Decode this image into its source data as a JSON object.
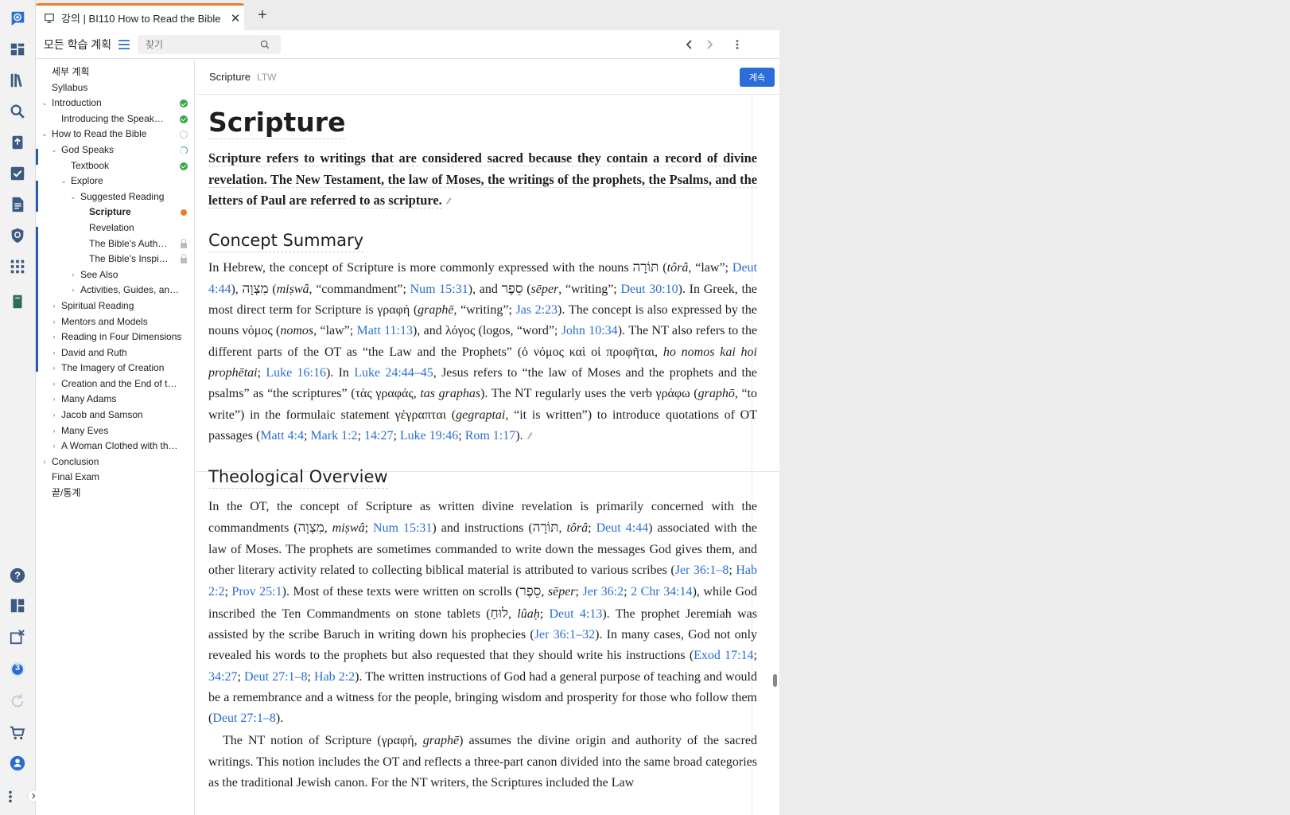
{
  "tab": {
    "title": "강의 | BI110 How to Read the Bible"
  },
  "toolbar": {
    "plan_label": "모든 학습 계획",
    "search_placeholder": "찾기"
  },
  "tree": [
    {
      "label": "세부 계획",
      "level": 0,
      "chevron": "none"
    },
    {
      "label": "Syllabus",
      "level": 0,
      "chevron": "none"
    },
    {
      "label": "Introduction",
      "level": 0,
      "chevron": "open",
      "status": "done"
    },
    {
      "label": "Introducing the Speak…",
      "level": 1,
      "chevron": "none",
      "status": "done"
    },
    {
      "label": "How to Read the Bible",
      "level": 0,
      "chevron": "open",
      "status": "empty"
    },
    {
      "label": "God Speaks",
      "level": 1,
      "chevron": "open",
      "status": "half"
    },
    {
      "label": "Textbook",
      "level": 2,
      "chevron": "none",
      "status": "done"
    },
    {
      "label": "Explore",
      "level": 2,
      "chevron": "open"
    },
    {
      "label": "Suggested Reading",
      "level": 3,
      "chevron": "open"
    },
    {
      "label": "Scripture",
      "level": 4,
      "chevron": "none",
      "status": "current",
      "active": true
    },
    {
      "label": "Revelation",
      "level": 4,
      "chevron": "none"
    },
    {
      "label": "The Bible's Auth…",
      "level": 4,
      "chevron": "none",
      "status": "locked"
    },
    {
      "label": "The Bible's Inspi…",
      "level": 4,
      "chevron": "none",
      "status": "locked"
    },
    {
      "label": "See Also",
      "level": 3,
      "chevron": "closed"
    },
    {
      "label": "Activities, Guides, and…",
      "level": 3,
      "chevron": "closed"
    },
    {
      "label": "Spiritual Reading",
      "level": 1,
      "chevron": "closed"
    },
    {
      "label": "Mentors and Models",
      "level": 1,
      "chevron": "closed"
    },
    {
      "label": "Reading in Four Dimensions",
      "level": 1,
      "chevron": "closed"
    },
    {
      "label": "David and Ruth",
      "level": 1,
      "chevron": "closed"
    },
    {
      "label": "The Imagery of Creation",
      "level": 1,
      "chevron": "closed"
    },
    {
      "label": "Creation and the End of th…",
      "level": 1,
      "chevron": "closed"
    },
    {
      "label": "Many Adams",
      "level": 1,
      "chevron": "closed"
    },
    {
      "label": "Jacob and Samson",
      "level": 1,
      "chevron": "closed"
    },
    {
      "label": "Many Eves",
      "level": 1,
      "chevron": "closed"
    },
    {
      "label": "A Woman Clothed with th…",
      "level": 1,
      "chevron": "closed"
    },
    {
      "label": "Conclusion",
      "level": 0,
      "chevron": "closed"
    },
    {
      "label": "Final Exam",
      "level": 0,
      "chevron": "none"
    },
    {
      "label": "끝/통계",
      "level": 0,
      "chevron": "none"
    }
  ],
  "reader": {
    "title": "Scripture",
    "source": "LTW",
    "continue_label": "계속"
  },
  "article": {
    "title": "Scripture",
    "lead": "Scripture refers to writings that are considered sacred because they contain a record of divine revelation. The New Testament, the law of Moses, the writings of the prophets, the Psalms, and the letters of Paul are referred to as scripture.",
    "sec1": "Concept Summary",
    "p1": {
      "a": "In Hebrew, the concept of Scripture is more commonly expressed with the nouns ",
      "heb_tora": "תּוֹרָה",
      "b": " (",
      "tora": "tôrâ",
      "c": ", “law”; ",
      "r_deut444": "Deut 4:44",
      "d": "), ",
      "heb_mitswa": "מִצְוָה",
      "e": " (",
      "mitswa": "miṣwâ",
      "f": ", “commandment”; ",
      "r_num1531": "Num 15:31",
      "g": "), and ",
      "heb_seper": "סֵפֶר",
      "h": " (",
      "seper": "sēper",
      "i": ", “writing”; ",
      "r_deut3010": "Deut 30:10",
      "j": "). In Greek, the most direct term for Scripture is γραφή (",
      "graphe": "graphē",
      "k": ", “writing”; ",
      "r_jas223": "Jas 2:23",
      "l": "). The concept is also expressed by the nouns νόμος (",
      "nomos": "nomos",
      "m": ", “law”; ",
      "r_matt1113": "Matt 11:13",
      "n": "), and λόγος (logos, “word”; ",
      "r_john1034": "John 10:34",
      "o": "). The NT also refers to the different parts of the OT as “the Law and the Prophets” (ὁ νόμος καὶ οἱ προφῆται, ",
      "translit": "ho nomos kai hoi prophētai",
      "p": "; ",
      "r_luke1616": "Luke 16:16",
      "q": "). In ",
      "r_luke2444": "Luke 24:44–45",
      "r": ", Jesus refers to “the law of Moses and the prophets and the psalms” as “the scriptures” (τὰς γραφάς, ",
      "tasgraphas": "tas graphas",
      "s": "). The NT regularly uses the verb γράφω (",
      "grapho": "graphō",
      "t": ", “to write”) in the formulaic statement γέγραπται (",
      "gegraptai": "gegraptai",
      "u": ", “it is written”) to introduce quotations of OT passages (",
      "r_matt44": "Matt 4:4",
      "v": "; ",
      "r_mark12": "Mark 1:2",
      "w": "; ",
      "r_1427": "14:27",
      "x": "; ",
      "r_luke1946": "Luke 19:46",
      "y": "; ",
      "r_rom117": "Rom 1:17",
      "z": ")."
    },
    "sec2": "Theological Overview",
    "p2": {
      "a": "In the OT, the concept of Scripture as written divine revelation is primarily concerned with the commandments (",
      "heb_mitswa": "מִצְוָה",
      "b": ", ",
      "mitswa": "miṣwâ",
      "c": "; ",
      "r_num1531": "Num 15:31",
      "d": ") and instructions (",
      "heb_tora": "תּוֹרָה",
      "e": ", ",
      "tora": "tôrâ",
      "f": "; ",
      "r_deut444": "Deut 4:44",
      "g": ") associated with the law of Moses. The prophets are sometimes commanded to write down the messages God gives them, and other literary activity related to collecting biblical material is attributed to various scribes (",
      "r_jer3618": "Jer 36:1–8",
      "h": "; ",
      "r_hab22": "Hab 2:2",
      "i": "; ",
      "r_prov251": "Prov 25:1",
      "j": "). Most of these texts were written on scrolls (",
      "heb_seper": "סֵפֶר",
      "k": ", ",
      "seper": "sēper",
      "l": "; ",
      "r_jer362": "Jer 36:2",
      "m": "; ",
      "r_2chr3414": "2 Chr 34:14",
      "n": "), while God inscribed the Ten Commandments on stone tablets (",
      "heb_luah": "לוּחַ",
      "o": ", ",
      "luah": "lûaḥ",
      "p": "; ",
      "r_deut413": "Deut 4:13",
      "q": "). The prophet Jeremiah was assisted by the scribe Baruch in writing down his prophecies (",
      "r_jer36132": "Jer 36:1–32",
      "r": "). In many cases, God not only revealed his words to the prophets but also requested that they should write his instructions (",
      "r_exod1714": "Exod 17:14",
      "s": "; ",
      "r_3427": "34:27",
      "t": "; ",
      "r_deut2718": "Deut 27:1–8",
      "u": "; ",
      "r_hab22b": "Hab 2:2",
      "v": "). The written instructions of God had a general purpose of teaching and would be a remembrance and a witness for the people, bringing wisdom and prosperity for those who follow them (",
      "r_deut2718b": "Deut 27:1–8",
      "w": ")."
    },
    "p3": {
      "a": "The NT notion of Scripture (γραφή, ",
      "graphe": "graphē",
      "b": ") assumes the divine origin and authority of the sacred writings. This notion includes the OT and reflects a three-part canon divided into the same broad categories as the traditional Jewish canon. For the NT writers, the Scriptures included the Law"
    }
  },
  "rail_badge": "3",
  "colors": {
    "accent": "#2b6ed8",
    "tab_highlight": "#f07c2a",
    "status_done": "#3aa44a",
    "link": "#2a6ed0"
  }
}
